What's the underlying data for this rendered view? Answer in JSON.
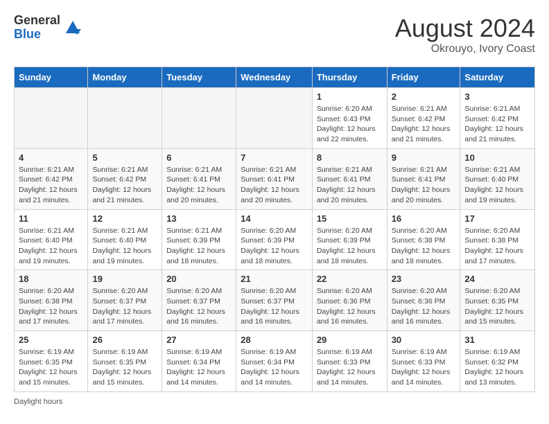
{
  "header": {
    "logo_general": "General",
    "logo_blue": "Blue",
    "title": "August 2024",
    "subtitle": "Okrouyo, Ivory Coast"
  },
  "days_of_week": [
    "Sunday",
    "Monday",
    "Tuesday",
    "Wednesday",
    "Thursday",
    "Friday",
    "Saturday"
  ],
  "weeks": [
    [
      {
        "day": "",
        "info": ""
      },
      {
        "day": "",
        "info": ""
      },
      {
        "day": "",
        "info": ""
      },
      {
        "day": "",
        "info": ""
      },
      {
        "day": "1",
        "info": "Sunrise: 6:20 AM\nSunset: 6:43 PM\nDaylight: 12 hours\nand 22 minutes."
      },
      {
        "day": "2",
        "info": "Sunrise: 6:21 AM\nSunset: 6:42 PM\nDaylight: 12 hours\nand 21 minutes."
      },
      {
        "day": "3",
        "info": "Sunrise: 6:21 AM\nSunset: 6:42 PM\nDaylight: 12 hours\nand 21 minutes."
      }
    ],
    [
      {
        "day": "4",
        "info": "Sunrise: 6:21 AM\nSunset: 6:42 PM\nDaylight: 12 hours\nand 21 minutes."
      },
      {
        "day": "5",
        "info": "Sunrise: 6:21 AM\nSunset: 6:42 PM\nDaylight: 12 hours\nand 21 minutes."
      },
      {
        "day": "6",
        "info": "Sunrise: 6:21 AM\nSunset: 6:41 PM\nDaylight: 12 hours\nand 20 minutes."
      },
      {
        "day": "7",
        "info": "Sunrise: 6:21 AM\nSunset: 6:41 PM\nDaylight: 12 hours\nand 20 minutes."
      },
      {
        "day": "8",
        "info": "Sunrise: 6:21 AM\nSunset: 6:41 PM\nDaylight: 12 hours\nand 20 minutes."
      },
      {
        "day": "9",
        "info": "Sunrise: 6:21 AM\nSunset: 6:41 PM\nDaylight: 12 hours\nand 20 minutes."
      },
      {
        "day": "10",
        "info": "Sunrise: 6:21 AM\nSunset: 6:40 PM\nDaylight: 12 hours\nand 19 minutes."
      }
    ],
    [
      {
        "day": "11",
        "info": "Sunrise: 6:21 AM\nSunset: 6:40 PM\nDaylight: 12 hours\nand 19 minutes."
      },
      {
        "day": "12",
        "info": "Sunrise: 6:21 AM\nSunset: 6:40 PM\nDaylight: 12 hours\nand 19 minutes."
      },
      {
        "day": "13",
        "info": "Sunrise: 6:21 AM\nSunset: 6:39 PM\nDaylight: 12 hours\nand 18 minutes."
      },
      {
        "day": "14",
        "info": "Sunrise: 6:20 AM\nSunset: 6:39 PM\nDaylight: 12 hours\nand 18 minutes."
      },
      {
        "day": "15",
        "info": "Sunrise: 6:20 AM\nSunset: 6:39 PM\nDaylight: 12 hours\nand 18 minutes."
      },
      {
        "day": "16",
        "info": "Sunrise: 6:20 AM\nSunset: 6:38 PM\nDaylight: 12 hours\nand 18 minutes."
      },
      {
        "day": "17",
        "info": "Sunrise: 6:20 AM\nSunset: 6:38 PM\nDaylight: 12 hours\nand 17 minutes."
      }
    ],
    [
      {
        "day": "18",
        "info": "Sunrise: 6:20 AM\nSunset: 6:38 PM\nDaylight: 12 hours\nand 17 minutes."
      },
      {
        "day": "19",
        "info": "Sunrise: 6:20 AM\nSunset: 6:37 PM\nDaylight: 12 hours\nand 17 minutes."
      },
      {
        "day": "20",
        "info": "Sunrise: 6:20 AM\nSunset: 6:37 PM\nDaylight: 12 hours\nand 16 minutes."
      },
      {
        "day": "21",
        "info": "Sunrise: 6:20 AM\nSunset: 6:37 PM\nDaylight: 12 hours\nand 16 minutes."
      },
      {
        "day": "22",
        "info": "Sunrise: 6:20 AM\nSunset: 6:36 PM\nDaylight: 12 hours\nand 16 minutes."
      },
      {
        "day": "23",
        "info": "Sunrise: 6:20 AM\nSunset: 6:36 PM\nDaylight: 12 hours\nand 16 minutes."
      },
      {
        "day": "24",
        "info": "Sunrise: 6:20 AM\nSunset: 6:35 PM\nDaylight: 12 hours\nand 15 minutes."
      }
    ],
    [
      {
        "day": "25",
        "info": "Sunrise: 6:19 AM\nSunset: 6:35 PM\nDaylight: 12 hours\nand 15 minutes."
      },
      {
        "day": "26",
        "info": "Sunrise: 6:19 AM\nSunset: 6:35 PM\nDaylight: 12 hours\nand 15 minutes."
      },
      {
        "day": "27",
        "info": "Sunrise: 6:19 AM\nSunset: 6:34 PM\nDaylight: 12 hours\nand 14 minutes."
      },
      {
        "day": "28",
        "info": "Sunrise: 6:19 AM\nSunset: 6:34 PM\nDaylight: 12 hours\nand 14 minutes."
      },
      {
        "day": "29",
        "info": "Sunrise: 6:19 AM\nSunset: 6:33 PM\nDaylight: 12 hours\nand 14 minutes."
      },
      {
        "day": "30",
        "info": "Sunrise: 6:19 AM\nSunset: 6:33 PM\nDaylight: 12 hours\nand 14 minutes."
      },
      {
        "day": "31",
        "info": "Sunrise: 6:19 AM\nSunset: 6:32 PM\nDaylight: 12 hours\nand 13 minutes."
      }
    ]
  ],
  "footer": {
    "daylight_label": "Daylight hours"
  }
}
